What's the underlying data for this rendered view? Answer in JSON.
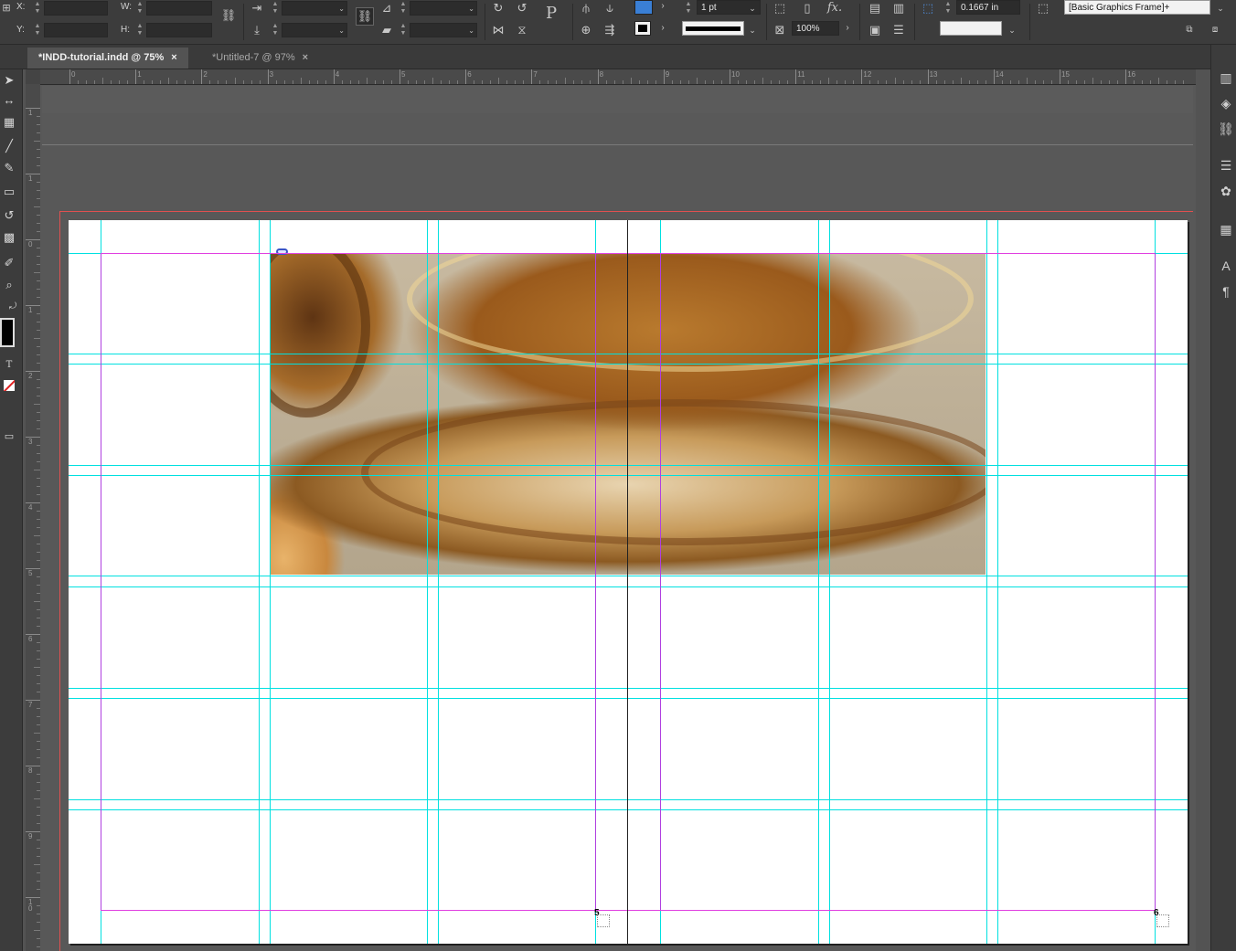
{
  "control_panel": {
    "x_label": "X:",
    "y_label": "Y:",
    "w_label": "W:",
    "h_label": "H:",
    "stroke_weight": "1 pt",
    "opacity": "100%",
    "offset": "0.1667 in",
    "object_style": "[Basic Graphics Frame]+",
    "fill_color": "#3a7fd5",
    "stroke_color": "#000000"
  },
  "tabs": [
    {
      "label": "*INDD-tutorial.indd @ 75%",
      "close": "×"
    },
    {
      "label": "*Untitled-7 @ 97%",
      "close": "×"
    }
  ],
  "ruler": {
    "horizontal": [
      "0",
      "1",
      "2",
      "3",
      "4",
      "5",
      "6",
      "7",
      "8",
      "9",
      "10",
      "11",
      "12",
      "13",
      "14",
      "15",
      "16"
    ],
    "vertical": [
      "1",
      "1",
      "0",
      "1",
      "2",
      "3",
      "4",
      "5",
      "6",
      "7",
      "8",
      "9",
      "1\n0"
    ]
  },
  "page_numbers": {
    "left": "5",
    "right": "6"
  },
  "tools": [
    "selection-tool",
    "gap-tool",
    "content-collector-tool",
    "line-tool",
    "pencil-tool",
    "rectangle-frame-tool",
    "rotate-tool",
    "gradient-tool",
    "eyedropper-tool",
    "zoom-tool",
    "swap-fill-stroke",
    "fill-stroke-swatch",
    "type-text-indicator",
    "apply-none",
    "screen-mode"
  ],
  "dock": [
    "pages-panel",
    "layers-panel",
    "links-panel",
    "stroke-panel",
    "swatches-panel",
    "table-panel",
    "character-styles-panel",
    "paragraph-styles-panel"
  ]
}
